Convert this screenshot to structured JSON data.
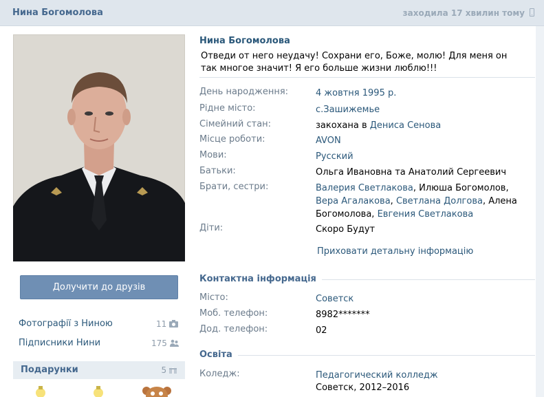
{
  "header": {
    "name": "Нина Богомолова",
    "status": "заходила 17 хвилин тому"
  },
  "profile": {
    "name": "Нина Богомолова",
    "status_text": "Отведи от него неудачу! Сохрани его, Боже, молю! Для меня он так многое значит! Я его больше жизни люблю!!!"
  },
  "sidebar": {
    "add_friend": "Долучити до друзів",
    "photos_label": "Фотографії з Ниною",
    "photos_count": "11",
    "followers_label": "Підписники Нини",
    "followers_count": "175",
    "gifts_label": "Подарунки",
    "gifts_count": "5"
  },
  "info": {
    "birthday_label": "День народження:",
    "birthday_value": "4 жовтня 1995 р.",
    "hometown_label": "Рідне місто:",
    "hometown_value": "с.Зашижемье",
    "family_label": "Сімейний стан:",
    "family_prefix": "закохана в",
    "family_link": "Дениса Сенова",
    "work_label": "Місце роботи:",
    "work_value": "AVON",
    "langs_label": "Мови:",
    "langs_value": "Русский",
    "parents_label": "Батьки:",
    "parents_value": "Ольга Ивановна та Анатолий Сергеевич",
    "siblings_label": "Брати, сестри:",
    "siblings": [
      {
        "text": "Валерия Светлакова",
        "link": true
      },
      {
        "text": ", Илюша Богомолов, ",
        "link": false
      },
      {
        "text": "Вера Агалакова",
        "link": true
      },
      {
        "text": ", ",
        "link": false
      },
      {
        "text": "Светлана Долгова",
        "link": true
      },
      {
        "text": ", Алена Богомолова, ",
        "link": false
      },
      {
        "text": "Евгения Светлакова",
        "link": true
      }
    ],
    "children_label": "Діти:",
    "children_value": "Скоро Будут",
    "hide_details": "Приховати детальну інформацію"
  },
  "contacts": {
    "title": "Контактна інформація",
    "city_label": "Місто:",
    "city_value": "Советск",
    "mobile_label": "Моб. телефон:",
    "mobile_value": "8982*******",
    "home_label": "Дод. телефон:",
    "home_value": "02"
  },
  "education": {
    "title": "Освіта",
    "college_label": "Коледж:",
    "college_value": "Педагогический колледж",
    "college_detail": "Советск, 2012–2016"
  },
  "colors": {
    "link": "#2b587a",
    "header_bg": "#dfe6ed",
    "button": "#6f8fb4"
  }
}
